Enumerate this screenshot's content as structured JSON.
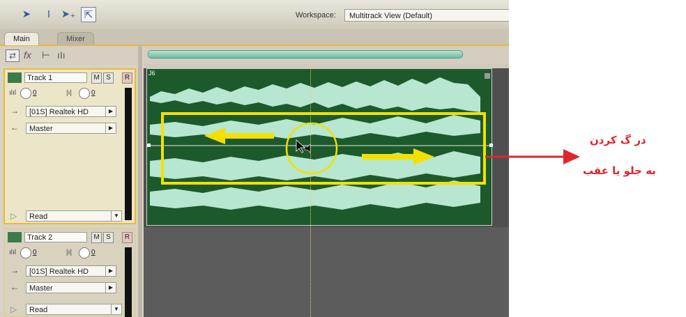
{
  "toolbar": {
    "workspace_label": "Workspace:",
    "workspace_value": "Multitrack View (Default)",
    "tools": [
      {
        "icon": "move-tool-icon"
      },
      {
        "icon": "time-selection-tool-icon"
      },
      {
        "icon": "move-copy-clip-tool-icon"
      },
      {
        "icon": "hybrid-tool-icon",
        "active": true
      }
    ]
  },
  "tabs": [
    {
      "label": "Main",
      "active": true
    },
    {
      "label": "Mixer",
      "active": false
    }
  ],
  "tracks": [
    {
      "name": "Track 1",
      "mute": "M",
      "solo": "S",
      "record": "R",
      "volume_value": "0",
      "pan_value": "0",
      "input": "[01S] Realtek HD",
      "output": "Master",
      "automation": "Read",
      "selected": true
    },
    {
      "name": "Track 2",
      "mute": "M",
      "solo": "S",
      "record": "R",
      "volume_value": "0",
      "pan_value": "0",
      "input": "[01S] Realtek HD",
      "output": "Master",
      "automation": "Read",
      "selected": false
    }
  ],
  "clip": {
    "label": "J6",
    "waveform_color": "#b7e6d1",
    "background_color": "#1c5a2b"
  },
  "overlay": {
    "highlight_color": "#f4e000",
    "arrow_left": "left-arrow-icon",
    "arrow_right": "right-arrow-icon"
  },
  "annotation": {
    "line1": "در گ کردن",
    "line2": "به جلو یا عقب",
    "color": "#e0262c"
  }
}
